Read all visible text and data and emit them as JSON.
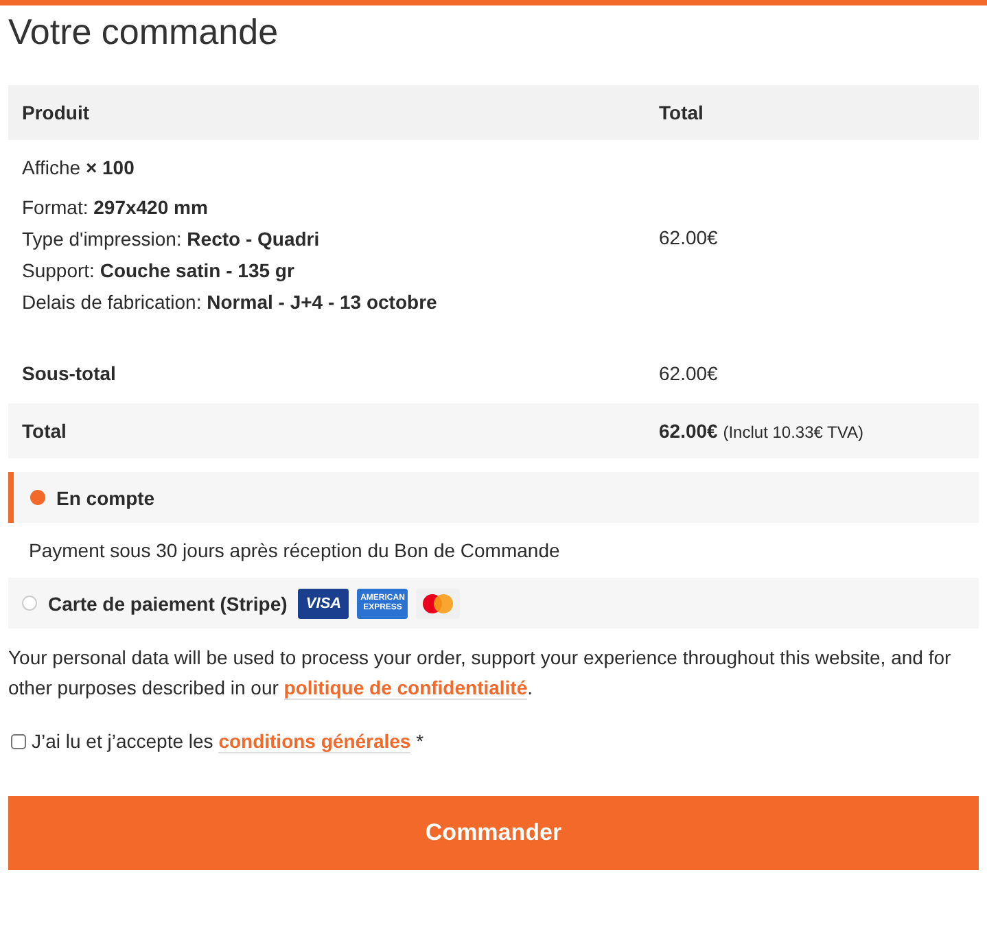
{
  "heading": "Votre commande",
  "table": {
    "columns": [
      "Produit",
      "Total"
    ],
    "item": {
      "name": "Affiche",
      "quantity": "× 100",
      "total": "62.00€",
      "meta": [
        {
          "label": "Format:",
          "value": "297x420 mm"
        },
        {
          "label": "Type d'impression:",
          "value": "Recto - Quadri"
        },
        {
          "label": "Support:",
          "value": "Couche satin - 135 gr"
        },
        {
          "label": "Delais de fabrication:",
          "value": "Normal - J+4 - 13 octobre"
        }
      ]
    },
    "subtotal": {
      "label": "Sous-total",
      "value": "62.00€"
    },
    "total": {
      "label": "Total",
      "value": "62.00€",
      "note": "(Inclut 10.33€ TVA)"
    }
  },
  "payment_methods": [
    {
      "label": "En compte",
      "selected": true,
      "description": "Payment sous 30 jours après réception du Bon de Commande"
    },
    {
      "label": "Carte de paiement (Stripe)",
      "selected": false,
      "cards": [
        {
          "kind": "visa",
          "text": "VISA"
        },
        {
          "kind": "amex",
          "text": "AMERICAN EXPRESS"
        },
        {
          "kind": "mastercard"
        }
      ]
    }
  ],
  "privacy": {
    "text": "Your personal data will be used to process your order, support your experience throughout this website, and for other purposes described in our ",
    "link": "politique de confidentialité",
    "end": "."
  },
  "terms": {
    "checked": false,
    "text": "J’ai lu et j’accepte les ",
    "link": "conditions générales",
    "required": "*"
  },
  "button": "Commander"
}
